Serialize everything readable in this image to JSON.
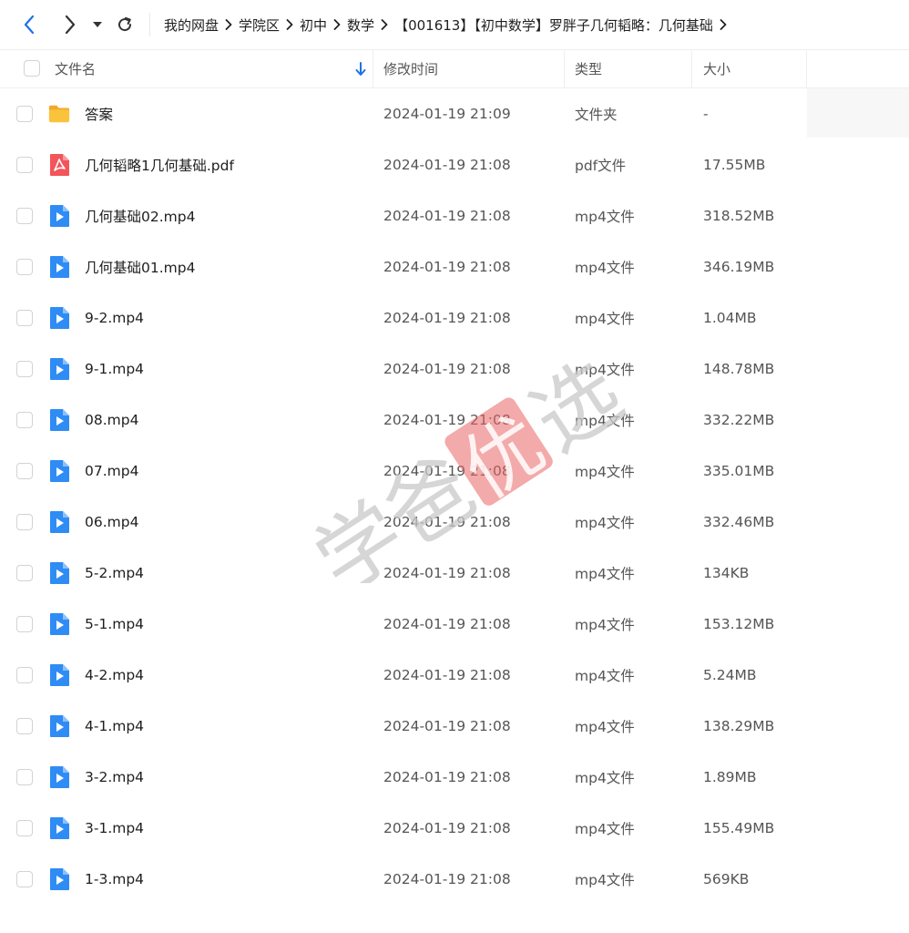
{
  "breadcrumb": [
    "我的网盘",
    "学院区",
    "初中",
    "数学",
    "【001613】【初中数学】罗胖子几何韬略：几何基础"
  ],
  "columns": {
    "name": "文件名",
    "modified": "修改时间",
    "type": "类型",
    "size": "大小"
  },
  "watermark": "学爸优选",
  "colors": {
    "accent": "#1a73e8",
    "folder": "#f9c33b",
    "video": "#2f8cf5",
    "pdf": "#f2555a",
    "watermark_gray": "#c8c8c8",
    "watermark_red": "#e96565"
  },
  "files": [
    {
      "name": "答案",
      "icon": "folder-icon",
      "modified": "2024-01-19 21:09",
      "type": "文件夹",
      "size": "-"
    },
    {
      "name": "几何韬略1几何基础.pdf",
      "icon": "pdf-file-icon",
      "modified": "2024-01-19 21:08",
      "type": "pdf文件",
      "size": "17.55MB"
    },
    {
      "name": "几何基础02.mp4",
      "icon": "video-file-icon",
      "modified": "2024-01-19 21:08",
      "type": "mp4文件",
      "size": "318.52MB"
    },
    {
      "name": "几何基础01.mp4",
      "icon": "video-file-icon",
      "modified": "2024-01-19 21:08",
      "type": "mp4文件",
      "size": "346.19MB"
    },
    {
      "name": "9-2.mp4",
      "icon": "video-file-icon",
      "modified": "2024-01-19 21:08",
      "type": "mp4文件",
      "size": "1.04MB"
    },
    {
      "name": "9-1.mp4",
      "icon": "video-file-icon",
      "modified": "2024-01-19 21:08",
      "type": "mp4文件",
      "size": "148.78MB"
    },
    {
      "name": "08.mp4",
      "icon": "video-file-icon",
      "modified": "2024-01-19 21:08",
      "type": "mp4文件",
      "size": "332.22MB"
    },
    {
      "name": "07.mp4",
      "icon": "video-file-icon",
      "modified": "2024-01-19 21:08",
      "type": "mp4文件",
      "size": "335.01MB"
    },
    {
      "name": "06.mp4",
      "icon": "video-file-icon",
      "modified": "2024-01-19 21:08",
      "type": "mp4文件",
      "size": "332.46MB"
    },
    {
      "name": "5-2.mp4",
      "icon": "video-file-icon",
      "modified": "2024-01-19 21:08",
      "type": "mp4文件",
      "size": "134KB"
    },
    {
      "name": "5-1.mp4",
      "icon": "video-file-icon",
      "modified": "2024-01-19 21:08",
      "type": "mp4文件",
      "size": "153.12MB"
    },
    {
      "name": "4-2.mp4",
      "icon": "video-file-icon",
      "modified": "2024-01-19 21:08",
      "type": "mp4文件",
      "size": "5.24MB"
    },
    {
      "name": "4-1.mp4",
      "icon": "video-file-icon",
      "modified": "2024-01-19 21:08",
      "type": "mp4文件",
      "size": "138.29MB"
    },
    {
      "name": "3-2.mp4",
      "icon": "video-file-icon",
      "modified": "2024-01-19 21:08",
      "type": "mp4文件",
      "size": "1.89MB"
    },
    {
      "name": "3-1.mp4",
      "icon": "video-file-icon",
      "modified": "2024-01-19 21:08",
      "type": "mp4文件",
      "size": "155.49MB"
    },
    {
      "name": "1-3.mp4",
      "icon": "video-file-icon",
      "modified": "2024-01-19 21:08",
      "type": "mp4文件",
      "size": "569KB"
    }
  ]
}
